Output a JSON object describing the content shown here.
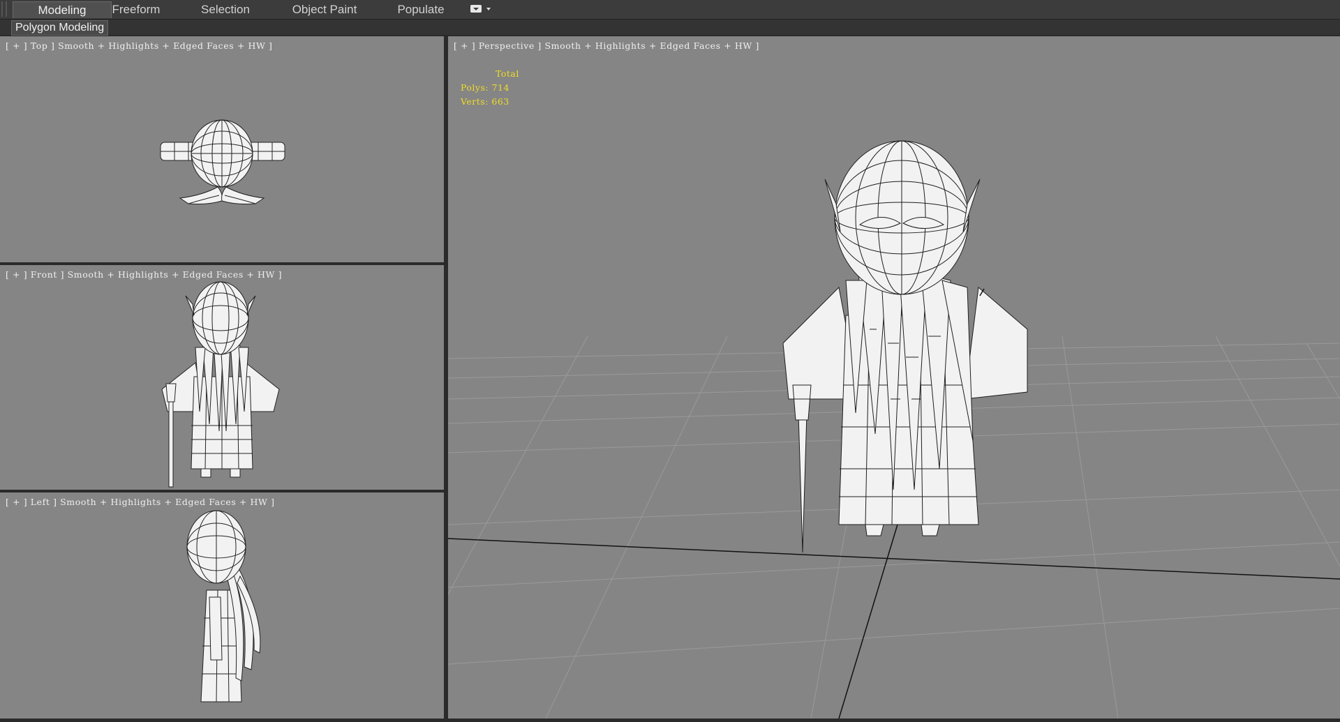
{
  "ribbon": {
    "tabs": [
      {
        "label": "Modeling",
        "active": true
      },
      {
        "label": "Freeform",
        "active": false
      },
      {
        "label": "Selection",
        "active": false
      },
      {
        "label": "Object Paint",
        "active": false
      },
      {
        "label": "Populate",
        "active": false
      }
    ],
    "panel_label": "Polygon Modeling"
  },
  "viewports": {
    "top": {
      "label": "[ + ] Top ] Smooth + Highlights + Edged Faces + HW ]"
    },
    "front": {
      "label": "[ + ] Front ] Smooth + Highlights + Edged Faces + HW ]"
    },
    "left": {
      "label": "[ + ] Left ] Smooth + Highlights + Edged Faces + HW ]"
    },
    "perspective": {
      "label": "[ + ] Perspective ] Smooth + Highlights + Edged Faces + HW ]",
      "stats": {
        "header": "Total",
        "polys": "Polys: 714",
        "verts": "Verts: 663"
      }
    }
  },
  "colors": {
    "viewport_bg": "#858585",
    "mesh_fill": "#f2f2f2",
    "wire": "#222222",
    "stats_text": "#f0dc28"
  },
  "icons": [
    "workspace-dropdown-icon"
  ]
}
